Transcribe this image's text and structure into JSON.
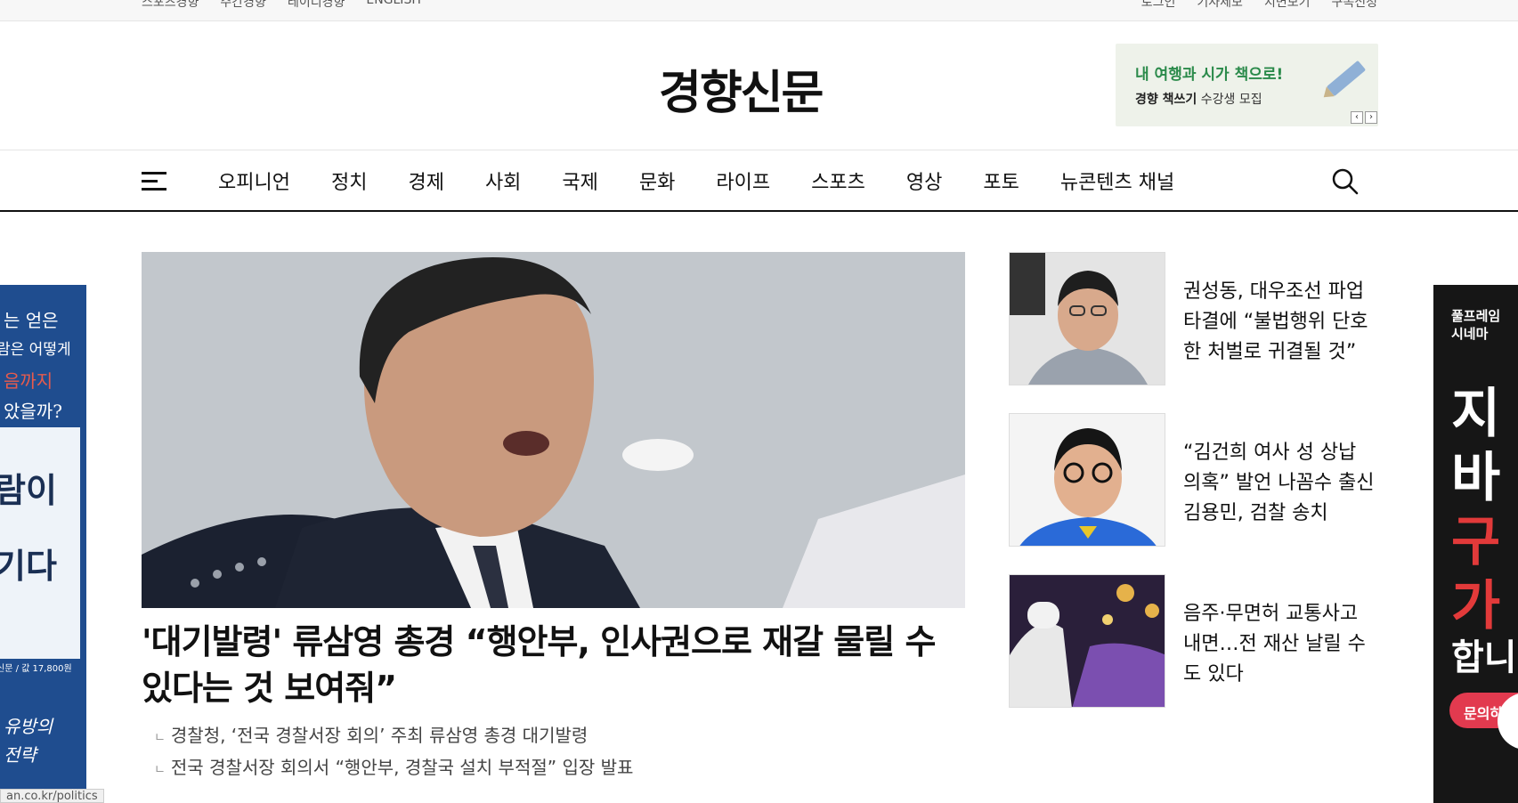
{
  "topbar": {
    "left_links": [
      "스포츠경향",
      "주간경향",
      "레이디경향",
      "ENGLISH"
    ],
    "right_links": [
      "로그인",
      "기사제보",
      "지면보기",
      "구독신청"
    ]
  },
  "header": {
    "logo": "경향신문",
    "banner": {
      "line1": "내 여행과 시가 책으로!",
      "line2_bold": "경향 책쓰기",
      "line2_rest": "수강생 모집",
      "prev": "‹",
      "next": "›"
    }
  },
  "nav": {
    "items": [
      "오피니언",
      "정치",
      "경제",
      "사회",
      "국제",
      "문화",
      "라이프",
      "스포츠",
      "영상",
      "포토",
      "뉴콘텐츠 채널"
    ]
  },
  "main": {
    "headline": "'대기발령' 류삼영 총경 “행안부, 인사권으로 재갈 물릴 수 있다는 것 보여줘”",
    "related": [
      "경찰청, ‘전국 경찰서장 회의’ 주최 류삼영 총경 대기발령",
      "전국 경찰서장 회의서 “행안부, 경찰국 설치 부적절” 입장 발표"
    ]
  },
  "side_news": [
    {
      "title": "권성동, 대우조선 파업 타결에 “불법행위 단호한 처벌로 귀결될 것”"
    },
    {
      "title": "“김건희 여사 성 상납 의혹” 발언 나꼼수 출신 김용민, 검찰 송치"
    },
    {
      "title": "음주·무면허 교통사고 내면…전 재산 날릴 수도 있다"
    }
  ],
  "ad_left": {
    "lines": [
      "는 얻은",
      "람은 어떻게",
      "음까지",
      "았을까?"
    ],
    "big1": "람이",
    "big2": "기다",
    "price": "신문 / 값 17,800원",
    "tail1": "유방의",
    "tail2": "전략"
  },
  "ad_right": {
    "top1": "풀프레임",
    "top2": "시네마",
    "b1": "지",
    "b2": "바",
    "b3": "구",
    "b4": "가",
    "b5": "합니",
    "button": "문의하"
  },
  "status_url": "an.co.kr/politics"
}
